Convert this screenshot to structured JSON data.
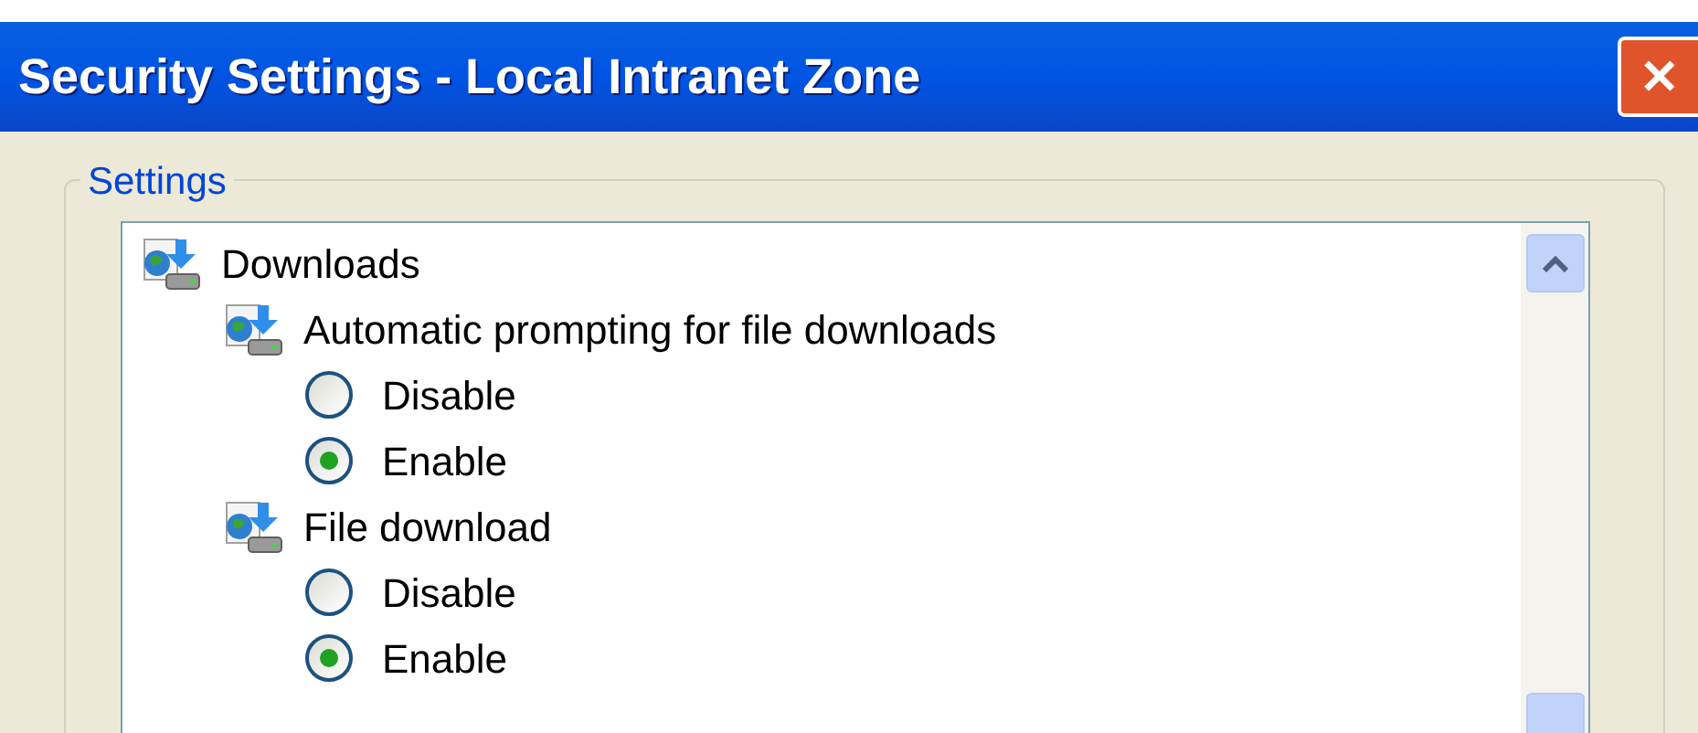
{
  "window": {
    "title": "Security Settings - Local Intranet Zone",
    "close_button": "✕"
  },
  "settings_group": {
    "label": "Settings",
    "tree": [
      {
        "label": "Downloads",
        "children": [
          {
            "label": "Automatic prompting for file downloads",
            "options": [
              {
                "label": "Disable",
                "selected": false
              },
              {
                "label": "Enable",
                "selected": true
              }
            ]
          },
          {
            "label": "File download",
            "options": [
              {
                "label": "Disable",
                "selected": false
              },
              {
                "label": "Enable",
                "selected": true
              }
            ]
          }
        ]
      }
    ]
  }
}
